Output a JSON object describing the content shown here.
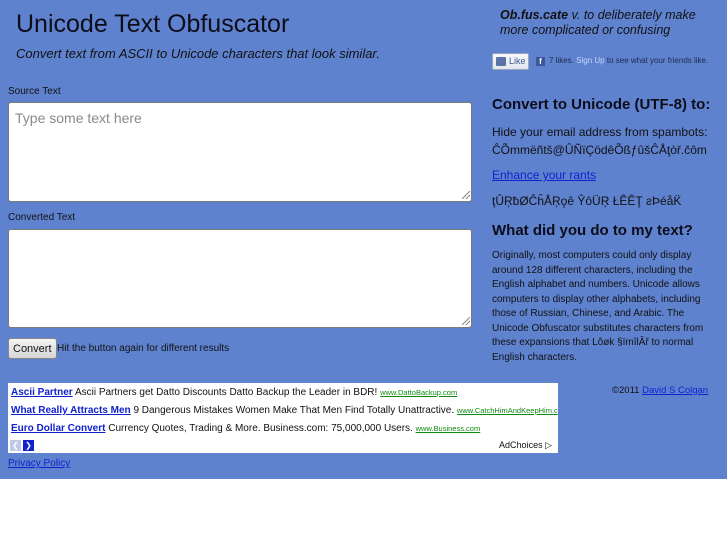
{
  "header": {
    "title": "Unicode Text Obfuscator",
    "subtitle": "Convert text from ASCII to Unicode characters that look similar."
  },
  "source": {
    "label": "Source Text",
    "placeholder": "Type some text here",
    "value": ""
  },
  "converted": {
    "label": "Converted Text",
    "value": ""
  },
  "actions": {
    "convert_label": "Convert",
    "hint": "Hit the button again for different results"
  },
  "definition": {
    "word": "Ob.fus.cate",
    "text": " v. to deliberately make more complicated or confusing"
  },
  "facebook": {
    "like_label": "Like",
    "fb_glyph": "f",
    "likes_text": "7 likes.",
    "signup_text": "Sign Up",
    "rest_text": "to see what your friends like."
  },
  "right": {
    "convert_heading": "Convert to Unicode (UTF-8) to:",
    "hide_email_text": "Hide your email address from spambots:",
    "email_example": "ĈÕmmëñtš@ÛÑïÇödêÕßƒûšĈÅţòř.čôm",
    "rant_link": "Enhance your rants",
    "rant_example": "ţÛŖƀØĈĥÅŖǫê ŶôÜŖ ŁÊÊŢ ƨÞéåK̈",
    "what_heading": "What did you do to my text?",
    "explanation": "Originally, most computers could only display around 128 different characters, including the English alphabet and numbers. Unicode allows computers to display other alphabets, including those of Russian, Chinese, and Arabic. The Unicode Obfuscator substitutes characters from these expansions that Lôøk §ïmîlÂř to normal English characters."
  },
  "footer": {
    "copyright": "©2011",
    "author": "David S Colgan",
    "privacy": "Privacy Policy"
  },
  "ads": [
    {
      "title": "Ascii Partner",
      "text": "Ascii Partners get Datto Discounts Datto Backup the Leader in BDR!",
      "url": "www.DattoBackup.com"
    },
    {
      "title": "What Really Attracts Men",
      "text": "9 Dangerous Mistakes Women Make That Men Find Totally Unattractive.",
      "url": "www.CatchHimAndKeepHim.c"
    },
    {
      "title": "Euro Dollar Convert",
      "text": "Currency Quotes, Trading & More. Business.com: 75,000,000 Users.",
      "url": "www.Business.com"
    }
  ],
  "ad_controls": {
    "prev_glyph": "❮",
    "next_glyph": "❯",
    "adchoices": "AdChoices ▷"
  }
}
